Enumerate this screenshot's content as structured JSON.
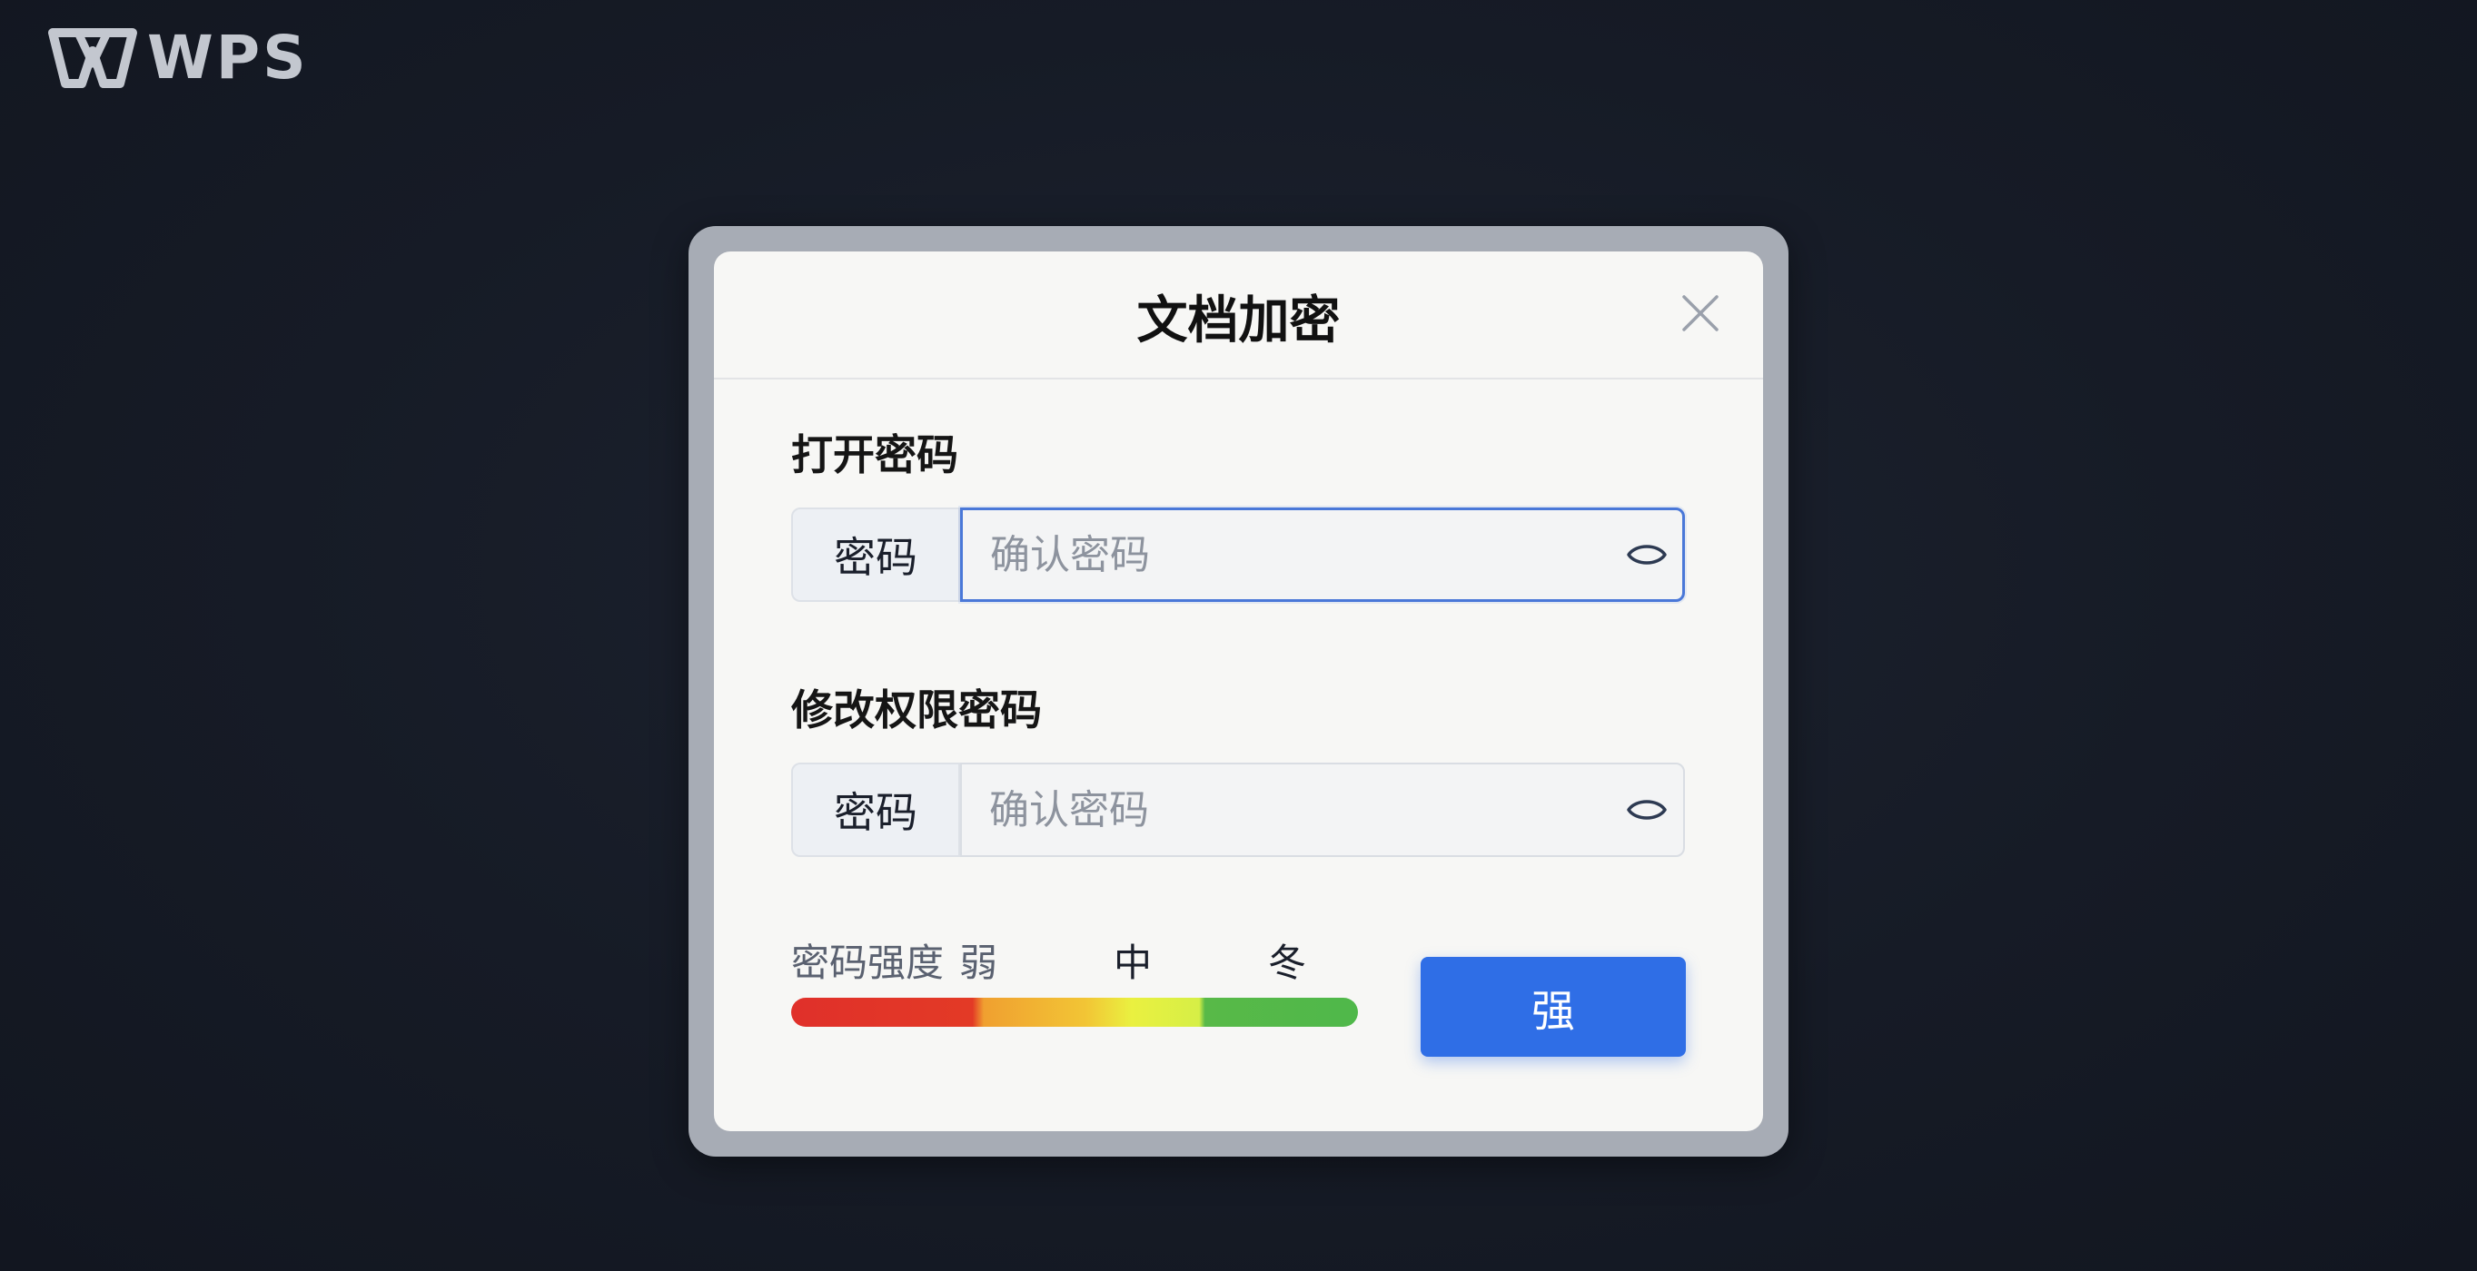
{
  "brand": {
    "logo_text": "WPS"
  },
  "dialog": {
    "title": "文档加密",
    "open_password": {
      "section_label": "打开密码",
      "prefix_label": "密码",
      "placeholder": "确认密码",
      "value": ""
    },
    "modify_password": {
      "section_label": "修改权限密码",
      "prefix_label": "密码",
      "placeholder": "确认密码",
      "value": ""
    },
    "strength": {
      "label": "密码强度",
      "levels": [
        "弱",
        "中",
        "冬"
      ],
      "colors": [
        "#e0302a",
        "#f2c535",
        "#4fb84a"
      ]
    },
    "confirm_button_label": "强"
  },
  "colors": {
    "accent": "#2f6ee6",
    "background": "#161b26",
    "dialog_background": "#f7f7f5"
  },
  "icons": {
    "logo": "wps-logo-icon",
    "close": "close-icon",
    "reveal": "eye-icon"
  }
}
